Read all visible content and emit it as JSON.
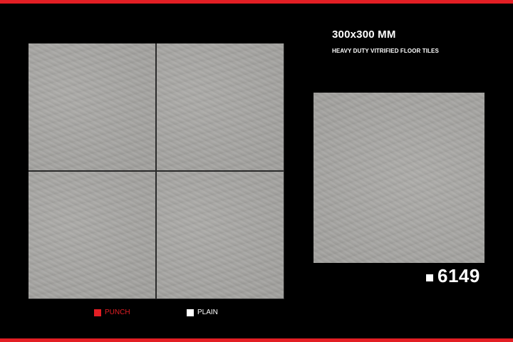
{
  "header": {
    "size": "300x300 MM",
    "description": "HEAVY DUTY VITRIFIED FLOOR TILES"
  },
  "product": {
    "code": "6149"
  },
  "legend": {
    "punch_label": "PUNCH",
    "plain_label": "PLAIN"
  },
  "colors": {
    "accent": "#e31e24",
    "background": "#000000",
    "tile": "#a6a5a2"
  }
}
